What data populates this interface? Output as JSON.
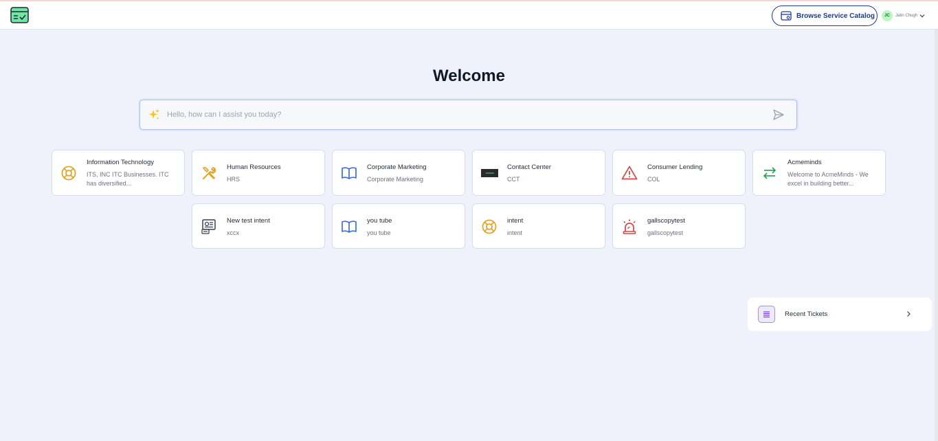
{
  "header": {
    "browse_label": "Browse Service Catalog",
    "user_initials": "JC",
    "user_name": "Jatin Chugh"
  },
  "welcome": "Welcome",
  "search": {
    "placeholder": "Hello, how can I assist you today?"
  },
  "cards": [
    {
      "title": "Information Technology",
      "desc": "ITS, INC ITC Businesses. ITC has diversified...",
      "icon": "lifebuoy-icon"
    },
    {
      "title": "Human Resources",
      "desc": "HRS",
      "icon": "tools-icon"
    },
    {
      "title": "Corporate Marketing",
      "desc": "Corporate Marketing",
      "icon": "book-icon"
    },
    {
      "title": "Contact Center",
      "desc": "CCT",
      "icon": "contact-center-logo"
    },
    {
      "title": "Consumer Lending",
      "desc": "COL",
      "icon": "warning-icon"
    },
    {
      "title": "Acmeminds",
      "desc": "Welcome to AcmeMinds - We excel in building better...",
      "icon": "arrows-exchange-icon"
    },
    {
      "title": "New test intent",
      "desc": "xccx",
      "icon": "id-card-icon"
    },
    {
      "title": "you tube",
      "desc": "you tube",
      "icon": "book-icon"
    },
    {
      "title": "intent",
      "desc": "intent",
      "icon": "lifebuoy-icon"
    },
    {
      "title": "gallscopytest",
      "desc": "gallscopytest",
      "icon": "siren-icon"
    }
  ],
  "recent": {
    "label": "Recent Tickets"
  },
  "colors": {
    "brand": "#1e3a8a",
    "lifebuoy": "#e0a526",
    "book": "#3b6fd6",
    "warning": "#d64545",
    "exchange": "#2fa05a"
  }
}
